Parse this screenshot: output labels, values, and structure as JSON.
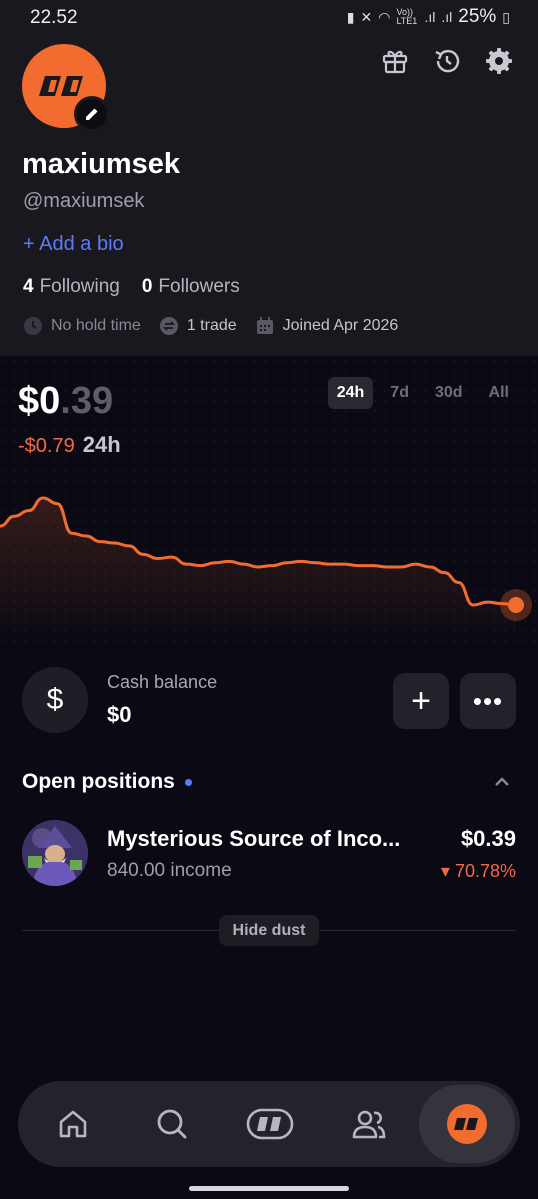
{
  "status_bar": {
    "time": "22.52",
    "battery": "25%",
    "network": "Vo)) LTE1"
  },
  "header": {
    "gift_icon": "gift-icon",
    "history_icon": "history-icon",
    "settings_icon": "gear-icon"
  },
  "profile": {
    "username": "maxiumsek",
    "handle": "@maxiumsek",
    "add_bio": "+ Add a bio",
    "following_count": "4",
    "following_label": "Following",
    "followers_count": "0",
    "followers_label": "Followers",
    "hold_time": "No hold time",
    "trades": "1 trade",
    "joined": "Joined Apr 2026",
    "avatar_color": "#f26b2f"
  },
  "portfolio": {
    "balance_whole": "$0",
    "balance_cents": ".39",
    "change": "-$0.79",
    "period": "24h",
    "timeframes": [
      "24h",
      "7d",
      "30d",
      "All"
    ],
    "active_timeframe": "24h"
  },
  "chart_data": {
    "type": "area",
    "color": "#f26b2f",
    "values": [
      0.95,
      1.02,
      1.06,
      1.15,
      1.11,
      0.9,
      0.88,
      0.84,
      0.83,
      0.81,
      0.75,
      0.72,
      0.73,
      0.68,
      0.67,
      0.69,
      0.7,
      0.68,
      0.66,
      0.67,
      0.69,
      0.7,
      0.69,
      0.68,
      0.68,
      0.67,
      0.67,
      0.66,
      0.66,
      0.68,
      0.66,
      0.62,
      0.55,
      0.39,
      0.41,
      0.4,
      0.39
    ]
  },
  "cash": {
    "label": "Cash balance",
    "value": "$0",
    "symbol": "$",
    "add_label": "+",
    "more_label": "•••"
  },
  "positions": {
    "header": "Open positions",
    "items": [
      {
        "name": "Mysterious Source of Inco...",
        "amount": "840.00 income",
        "value": "$0.39",
        "change": "▾ 70.78%"
      }
    ],
    "hide_dust": "Hide dust"
  },
  "nav": {
    "items": [
      "home-icon",
      "search-icon",
      "logo-icon",
      "people-icon",
      "profile-avatar-icon"
    ],
    "active": "profile-avatar-icon"
  }
}
